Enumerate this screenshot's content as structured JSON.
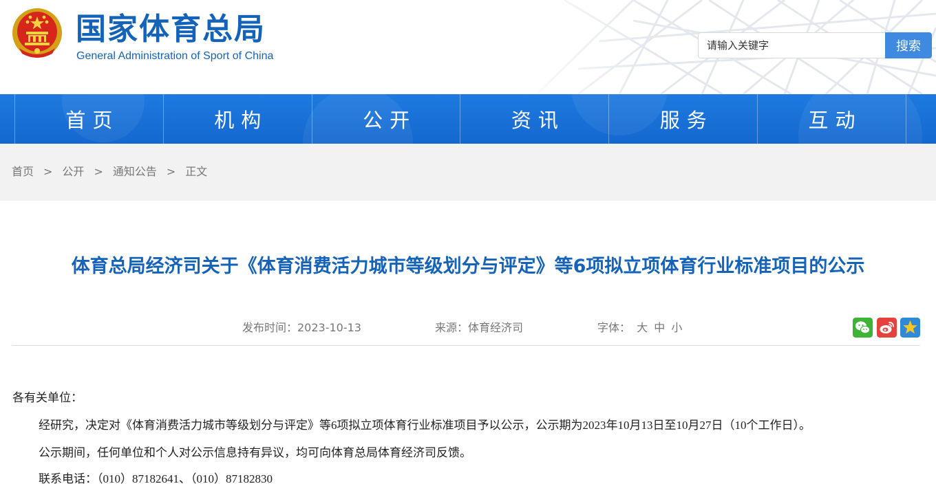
{
  "header": {
    "title_cn": "国家体育总局",
    "title_en": "General Administration of Sport of China",
    "search": {
      "placeholder": "请输入关键字",
      "button": "搜索"
    }
  },
  "nav": {
    "items": [
      "首页",
      "机构",
      "公开",
      "资讯",
      "服务",
      "互动"
    ]
  },
  "breadcrumb": {
    "items": [
      "首页",
      "公开",
      "通知公告",
      "正文"
    ],
    "separator": ">"
  },
  "article": {
    "title": "体育总局经济司关于《体育消费活力城市等级划分与评定》等6项拟立项体育行业标准项目的公示",
    "publish_time": "发布时间：2023-10-13",
    "source": "来源：体育经济司",
    "font_size_label": "字体：",
    "font_sizes": [
      "大",
      "中",
      "小"
    ],
    "share_icons": [
      "wechat-icon",
      "weibo-icon",
      "favorite-icon"
    ],
    "paragraphs": [
      "各有关单位：",
      "经研究，决定对《体育消费活力城市等级划分与评定》等6项拟立项体育行业标准项目予以公示，公示期为2023年10月13日至10月27日（10个工作日）。",
      "公示期间，任何单位和个人对公示信息持有异议，均可向体育总局体育经济司反馈。",
      "联系电话：（010）87182641、（010）87182830"
    ]
  },
  "colors": {
    "brand_blue": "#1463b9",
    "nav_blue": "#1a72d8",
    "search_button": "#3f8ae0",
    "breadcrumb_bg": "#f2f2f2"
  }
}
